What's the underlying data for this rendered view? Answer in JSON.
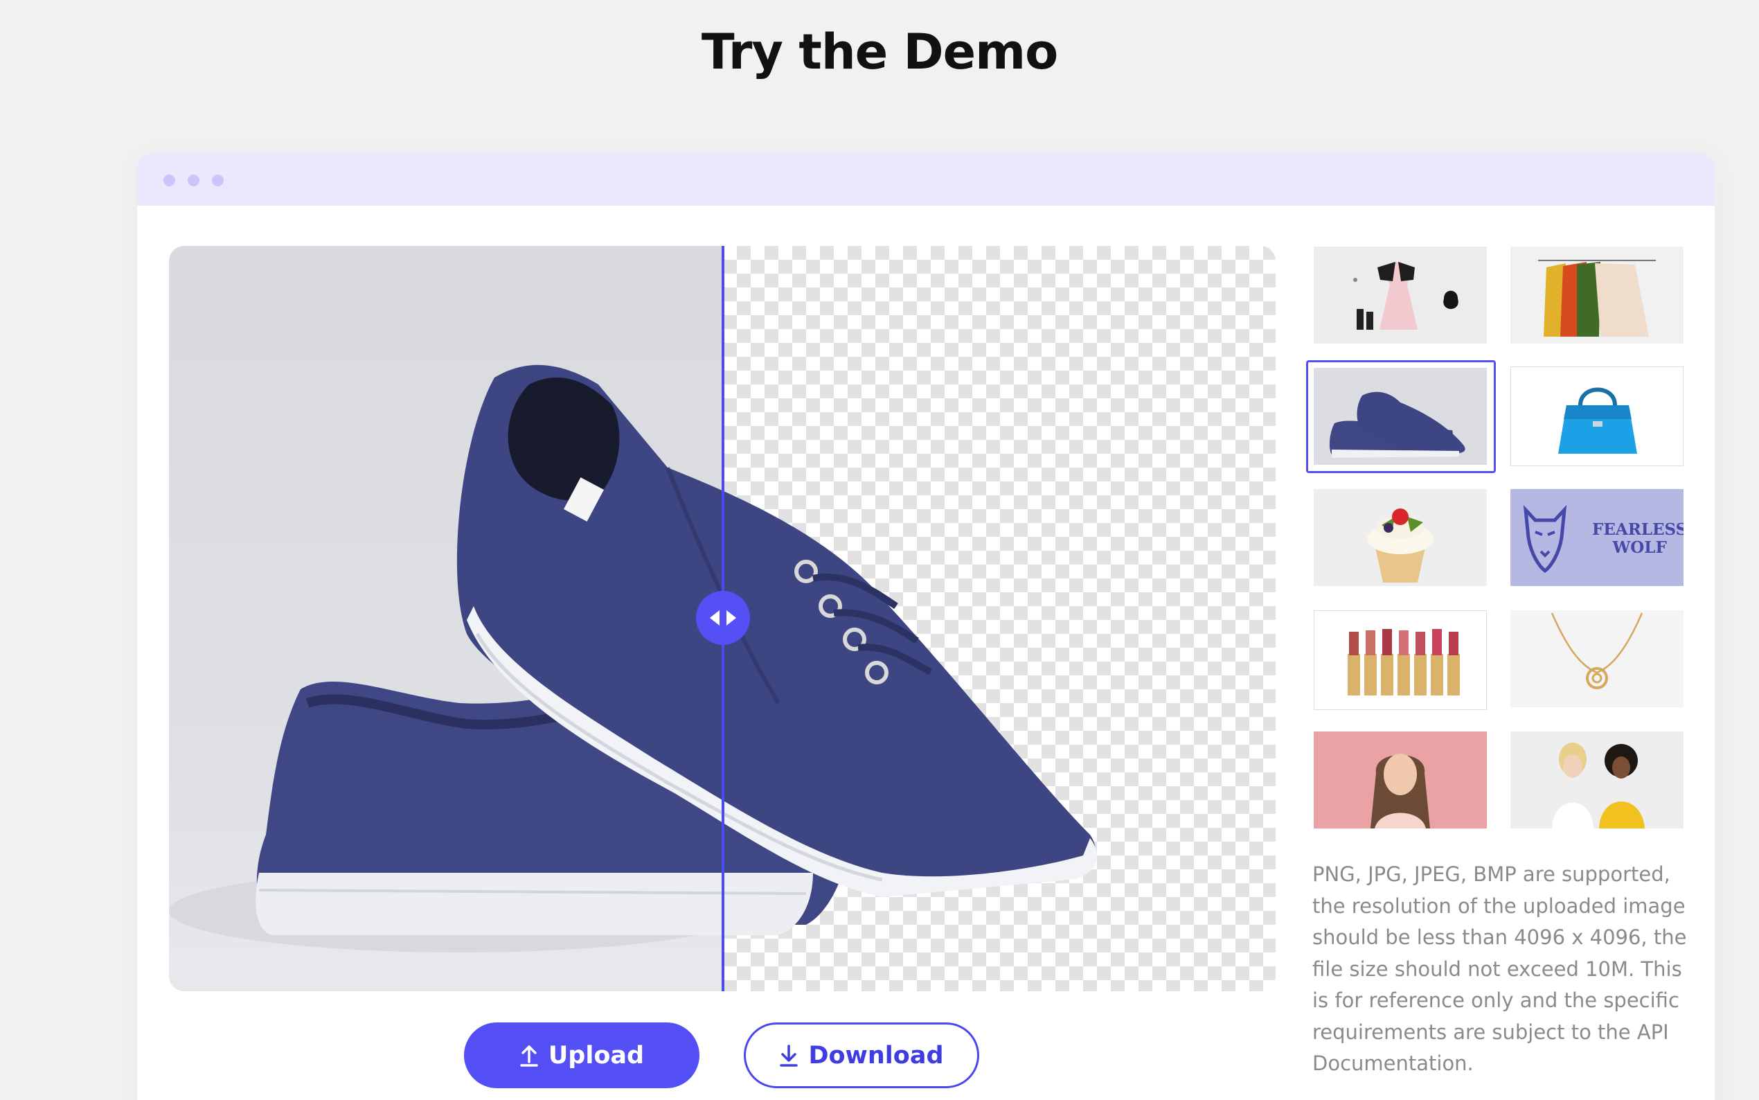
{
  "page": {
    "title": "Try the Demo"
  },
  "demo": {
    "upload_label": "Upload",
    "download_label": "Download",
    "help_text": "PNG, JPG, JPEG, BMP are supported, the resolution of the uploaded image should be less than 4096 x 4096, the file size should not exceed 10M. This is for reference only and the specific requirements are subject to the API Documentation.",
    "comparison_split_percent": 50,
    "selected_sample": "shoes",
    "samples": [
      {
        "name": "clothing-accessories"
      },
      {
        "name": "sweaters-on-hangers"
      },
      {
        "name": "shoes"
      },
      {
        "name": "blue-handbag"
      },
      {
        "name": "cupcake"
      },
      {
        "name": "logo",
        "text_line1": "FEARLESS",
        "text_line2": "WOLF"
      },
      {
        "name": "lipsticks"
      },
      {
        "name": "necklace"
      },
      {
        "name": "woman-portrait"
      },
      {
        "name": "two-people"
      }
    ]
  },
  "colors": {
    "accent": "#544ff5",
    "window_bar": "#ebe8fd",
    "window_dots": "#cdc5fa",
    "page_bg": "#f1f1f1",
    "shoe": "#3d4682"
  }
}
